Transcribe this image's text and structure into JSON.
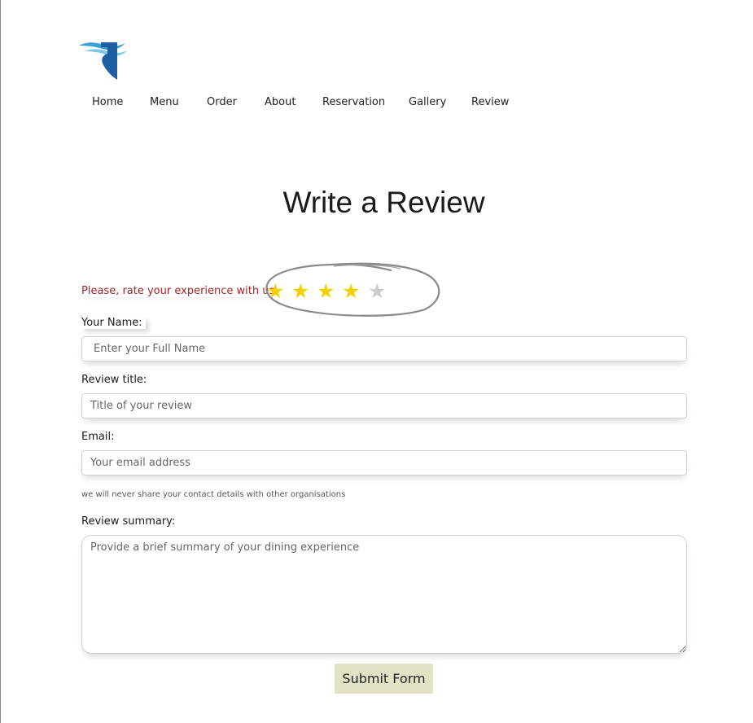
{
  "nav": {
    "items": [
      {
        "label": "Home"
      },
      {
        "label": "Menu"
      },
      {
        "label": "Order"
      },
      {
        "label": "About"
      },
      {
        "label": "Reservation"
      },
      {
        "label": "Gallery"
      },
      {
        "label": "Review"
      }
    ]
  },
  "page": {
    "title": "Write a Review"
  },
  "rating": {
    "prompt": "Please, rate your experience with us.",
    "value": 4,
    "max": 5,
    "filled_color": "#f5d000",
    "empty_color": "#cccccc"
  },
  "form": {
    "name": {
      "label": "Your Name:",
      "placeholder": "Enter your Full Name",
      "value": ""
    },
    "title": {
      "label": "Review title:",
      "placeholder": "Title of your review",
      "value": ""
    },
    "email": {
      "label": "Email:",
      "placeholder": "Your email address",
      "value": "",
      "helper": "we will never share your contact details with other organisations"
    },
    "summary": {
      "label": "Review summary:",
      "placeholder": "Provide a brief summary of your dining experience",
      "value": ""
    },
    "submit_label": "Submit Form"
  },
  "colors": {
    "prompt": "#a52424",
    "submit_bg": "#e4e2c4",
    "logo_blue": "#1c5fa3",
    "logo_light": "#3aa0d8"
  },
  "icons": {
    "logo": "bird-wave-logo-icon",
    "star": "star-icon"
  }
}
